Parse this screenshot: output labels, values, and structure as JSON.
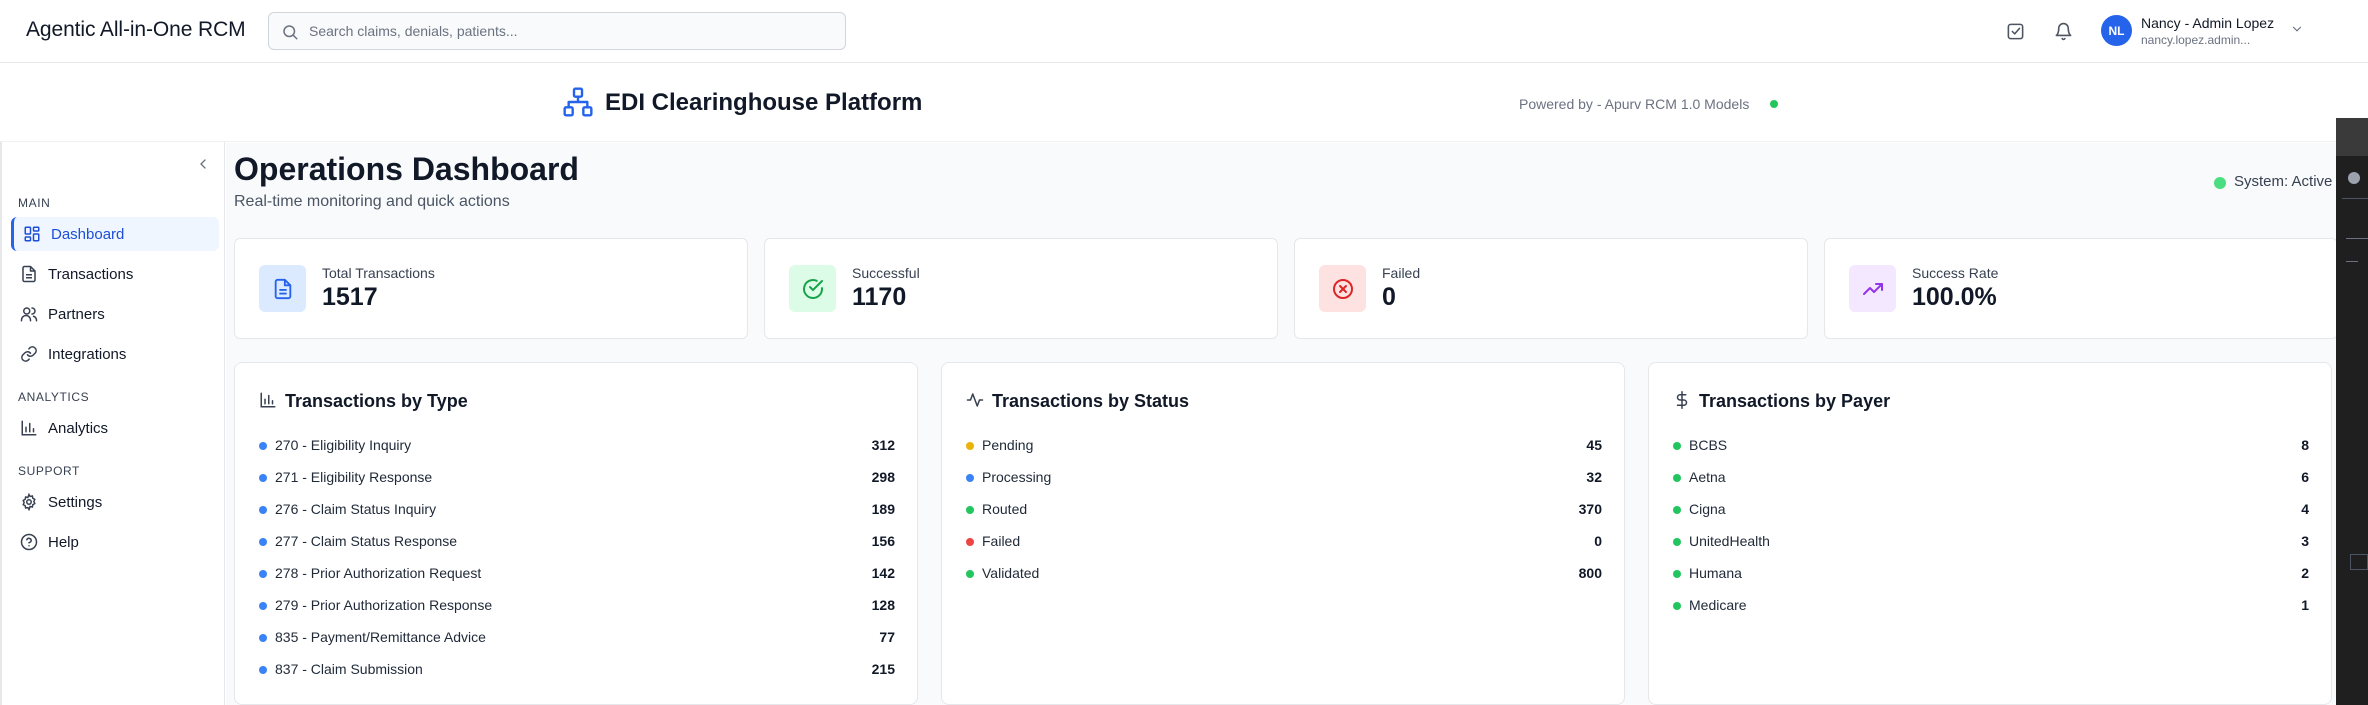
{
  "app": {
    "title": "Agentic All-in-One RCM"
  },
  "search": {
    "placeholder": "Search claims, denials, patients..."
  },
  "user": {
    "initials": "NL",
    "name": "Nancy - Admin Lopez",
    "email": "nancy.lopez.admin..."
  },
  "platform": {
    "title": "EDI Clearinghouse Platform",
    "powered_by": "Powered by - Apurv RCM 1.0 Models",
    "status_color": "#22c55e"
  },
  "sidebar": {
    "sections": [
      {
        "label": "MAIN",
        "items": [
          {
            "label": "Dashboard",
            "icon": "dashboard-icon",
            "active": true
          },
          {
            "label": "Transactions",
            "icon": "document-icon",
            "active": false
          },
          {
            "label": "Partners",
            "icon": "users-icon",
            "active": false
          },
          {
            "label": "Integrations",
            "icon": "link-icon",
            "active": false
          }
        ]
      },
      {
        "label": "ANALYTICS",
        "items": [
          {
            "label": "Analytics",
            "icon": "bar-chart-icon",
            "active": false
          }
        ]
      },
      {
        "label": "SUPPORT",
        "items": [
          {
            "label": "Settings",
            "icon": "gear-icon",
            "active": false
          },
          {
            "label": "Help",
            "icon": "help-icon",
            "active": false
          }
        ]
      }
    ]
  },
  "dashboard": {
    "title": "Operations Dashboard",
    "subtitle": "Real-time monitoring and quick actions",
    "system_status": "System: Active",
    "stats": [
      {
        "label": "Total Transactions",
        "value": "1517",
        "icon": "document-icon",
        "bg": "#dbeafe",
        "color": "#2563eb"
      },
      {
        "label": "Successful",
        "value": "1170",
        "icon": "check-circle-icon",
        "bg": "#dcfce7",
        "color": "#16a34a"
      },
      {
        "label": "Failed",
        "value": "0",
        "icon": "x-circle-icon",
        "bg": "#fee2e2",
        "color": "#dc2626"
      },
      {
        "label": "Success Rate",
        "value": "100.0%",
        "icon": "trending-up-icon",
        "bg": "#f3e8ff",
        "color": "#9333ea"
      }
    ],
    "panels": {
      "by_type": {
        "title": "Transactions by Type",
        "icon": "bar-chart-icon",
        "rows": [
          {
            "label": "270 - Eligibility Inquiry",
            "value": "312",
            "color": "#3b82f6"
          },
          {
            "label": "271 - Eligibility Response",
            "value": "298",
            "color": "#3b82f6"
          },
          {
            "label": "276 - Claim Status Inquiry",
            "value": "189",
            "color": "#3b82f6"
          },
          {
            "label": "277 - Claim Status Response",
            "value": "156",
            "color": "#3b82f6"
          },
          {
            "label": "278 - Prior Authorization Request",
            "value": "142",
            "color": "#3b82f6"
          },
          {
            "label": "279 - Prior Authorization Response",
            "value": "128",
            "color": "#3b82f6"
          },
          {
            "label": "835 - Payment/Remittance Advice",
            "value": "77",
            "color": "#3b82f6"
          },
          {
            "label": "837 - Claim Submission",
            "value": "215",
            "color": "#3b82f6"
          }
        ]
      },
      "by_status": {
        "title": "Transactions by Status",
        "icon": "activity-icon",
        "rows": [
          {
            "label": "Pending",
            "value": "45",
            "color": "#eab308"
          },
          {
            "label": "Processing",
            "value": "32",
            "color": "#3b82f6"
          },
          {
            "label": "Routed",
            "value": "370",
            "color": "#22c55e"
          },
          {
            "label": "Failed",
            "value": "0",
            "color": "#ef4444"
          },
          {
            "label": "Validated",
            "value": "800",
            "color": "#22c55e"
          }
        ]
      },
      "by_payer": {
        "title": "Transactions by Payer",
        "icon": "dollar-icon",
        "rows": [
          {
            "label": "BCBS",
            "value": "8",
            "color": "#22c55e"
          },
          {
            "label": "Aetna",
            "value": "6",
            "color": "#22c55e"
          },
          {
            "label": "Cigna",
            "value": "4",
            "color": "#22c55e"
          },
          {
            "label": "UnitedHealth",
            "value": "3",
            "color": "#22c55e"
          },
          {
            "label": "Humana",
            "value": "2",
            "color": "#22c55e"
          },
          {
            "label": "Medicare",
            "value": "1",
            "color": "#22c55e"
          }
        ]
      }
    }
  }
}
